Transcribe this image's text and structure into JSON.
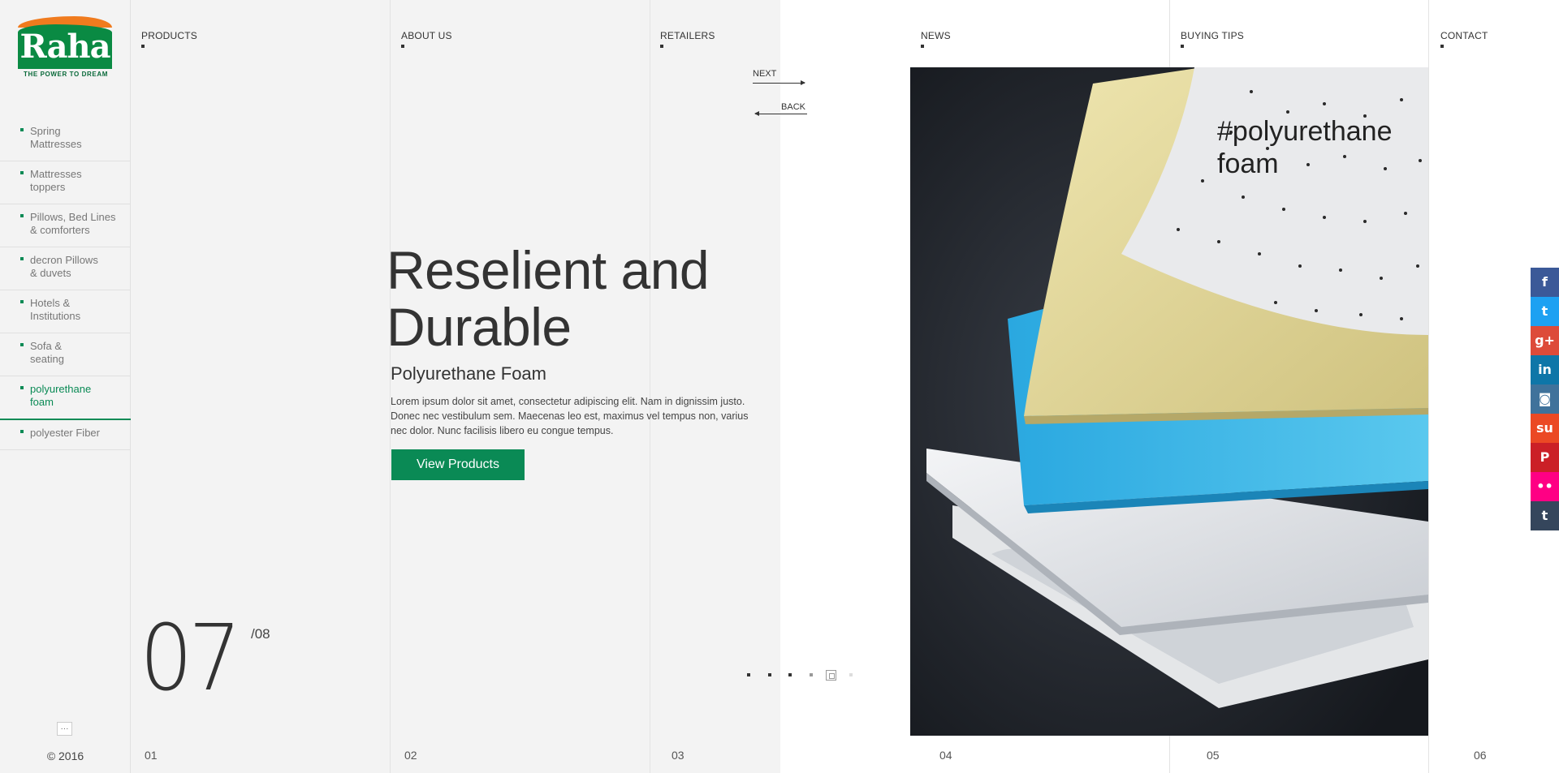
{
  "brand": {
    "name": "Raha",
    "tagline": "THE POWER TO DREAM",
    "colors": {
      "orange": "#f07b1e",
      "green": "#0a8a43",
      "accent": "#0a8a55"
    }
  },
  "sidebar": {
    "items": [
      {
        "label": "Spring\nMattresses",
        "active": false
      },
      {
        "label": "Mattresses\ntoppers",
        "active": false
      },
      {
        "label": "Pillows, Bed Lines\n& comforters",
        "active": false
      },
      {
        "label": "decron Pillows\n& duvets",
        "active": false
      },
      {
        "label": "Hotels &\nInstitutions",
        "active": false
      },
      {
        "label": "Sofa &\nseating",
        "active": false
      },
      {
        "label": "polyurethane\nfoam",
        "active": true
      },
      {
        "label": "polyester Fiber",
        "active": false
      }
    ],
    "more_label": "···",
    "copyright": "© 2016"
  },
  "topnav": {
    "products": "PRODUCTS",
    "about": "ABOUT US",
    "retailers": "RETAILERS",
    "news": "NEWS",
    "buying_tips": "BUYING TIPS",
    "contact": "CONTACT"
  },
  "slider": {
    "next_label": "NEXT",
    "back_label": "BACK",
    "current": "07",
    "total": "/08",
    "dot_count": 6,
    "active_dot": 4
  },
  "hero": {
    "headline": "Reselient and Durable",
    "subheading": "Polyurethane Foam",
    "body": "Lorem ipsum dolor sit amet, consectetur adipiscing elit. Nam in dignissim justo. Donec nec vestibulum sem. Maecenas leo est, maximus vel tempus non, varius nec dolor. Nunc facilisis libero eu congue tempus.",
    "cta_label": "View Products",
    "hashtag": "#polyurethane\n  foam"
  },
  "columns": [
    "01",
    "02",
    "03",
    "04",
    "05",
    "06"
  ],
  "social": [
    {
      "icon": "facebook-icon",
      "glyph": "f",
      "color": "#3b5998"
    },
    {
      "icon": "twitter-icon",
      "glyph": "t",
      "color": "#1da1f2"
    },
    {
      "icon": "google-plus-icon",
      "glyph": "g+",
      "color": "#dd4b39"
    },
    {
      "icon": "linkedin-icon",
      "glyph": "in",
      "color": "#0e76a8"
    },
    {
      "icon": "instagram-icon",
      "glyph": "◙",
      "color": "#3f729b"
    },
    {
      "icon": "stumbleupon-icon",
      "glyph": "su",
      "color": "#eb4924"
    },
    {
      "icon": "pinterest-icon",
      "glyph": "P",
      "color": "#cb2027"
    },
    {
      "icon": "flickr-icon",
      "glyph": "••",
      "color": "#ff0084"
    },
    {
      "icon": "tumblr-icon",
      "glyph": "t",
      "color": "#35465c"
    }
  ]
}
